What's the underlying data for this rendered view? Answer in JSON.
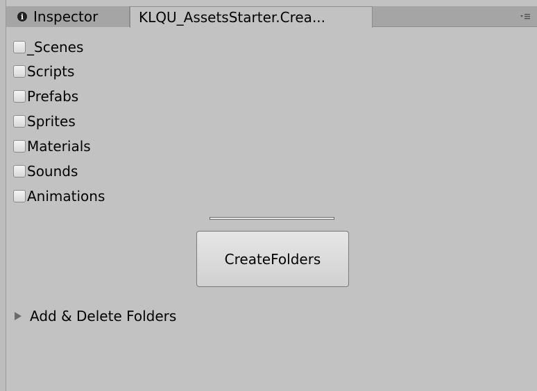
{
  "tabs": {
    "inspector_label": "Inspector",
    "active_label": "KLQU_AssetsStarter.Crea..."
  },
  "icons": {
    "info": "info-icon",
    "menu": "tab-menu-icon",
    "foldout": "foldout-arrow-icon"
  },
  "folders": [
    {
      "label": "_Scenes",
      "checked": false
    },
    {
      "label": "Scripts",
      "checked": false
    },
    {
      "label": "Prefabs",
      "checked": false
    },
    {
      "label": "Sprites",
      "checked": false
    },
    {
      "label": "Materials",
      "checked": false
    },
    {
      "label": "Sounds",
      "checked": false
    },
    {
      "label": "Animations",
      "checked": false
    }
  ],
  "create_button_label": "CreateFolders",
  "foldout_label": "Add & Delete Folders",
  "colors": {
    "background": "#c2c2c2",
    "tab_bar": "#a5a5a5"
  }
}
